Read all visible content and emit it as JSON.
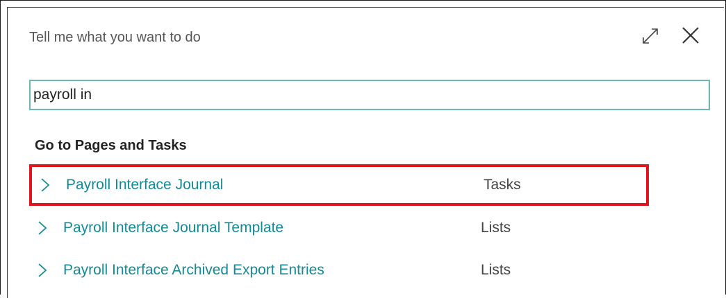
{
  "dialog": {
    "title": "Tell me what you want to do",
    "expand_icon": "expand-diagonal-icon",
    "close_icon": "close-x-icon"
  },
  "search": {
    "value": "payroll in"
  },
  "section": {
    "heading": "Go to Pages and Tasks"
  },
  "results": [
    {
      "name": "Payroll Interface Journal",
      "category": "Tasks",
      "highlighted": true
    },
    {
      "name": "Payroll Interface Journal Template",
      "category": "Lists",
      "highlighted": false
    },
    {
      "name": "Payroll Interface Archived Export Entries",
      "category": "Lists",
      "highlighted": false
    }
  ],
  "colors": {
    "link": "#138a94",
    "input_border": "#6fb7b3",
    "highlight_border": "#e0141e"
  }
}
